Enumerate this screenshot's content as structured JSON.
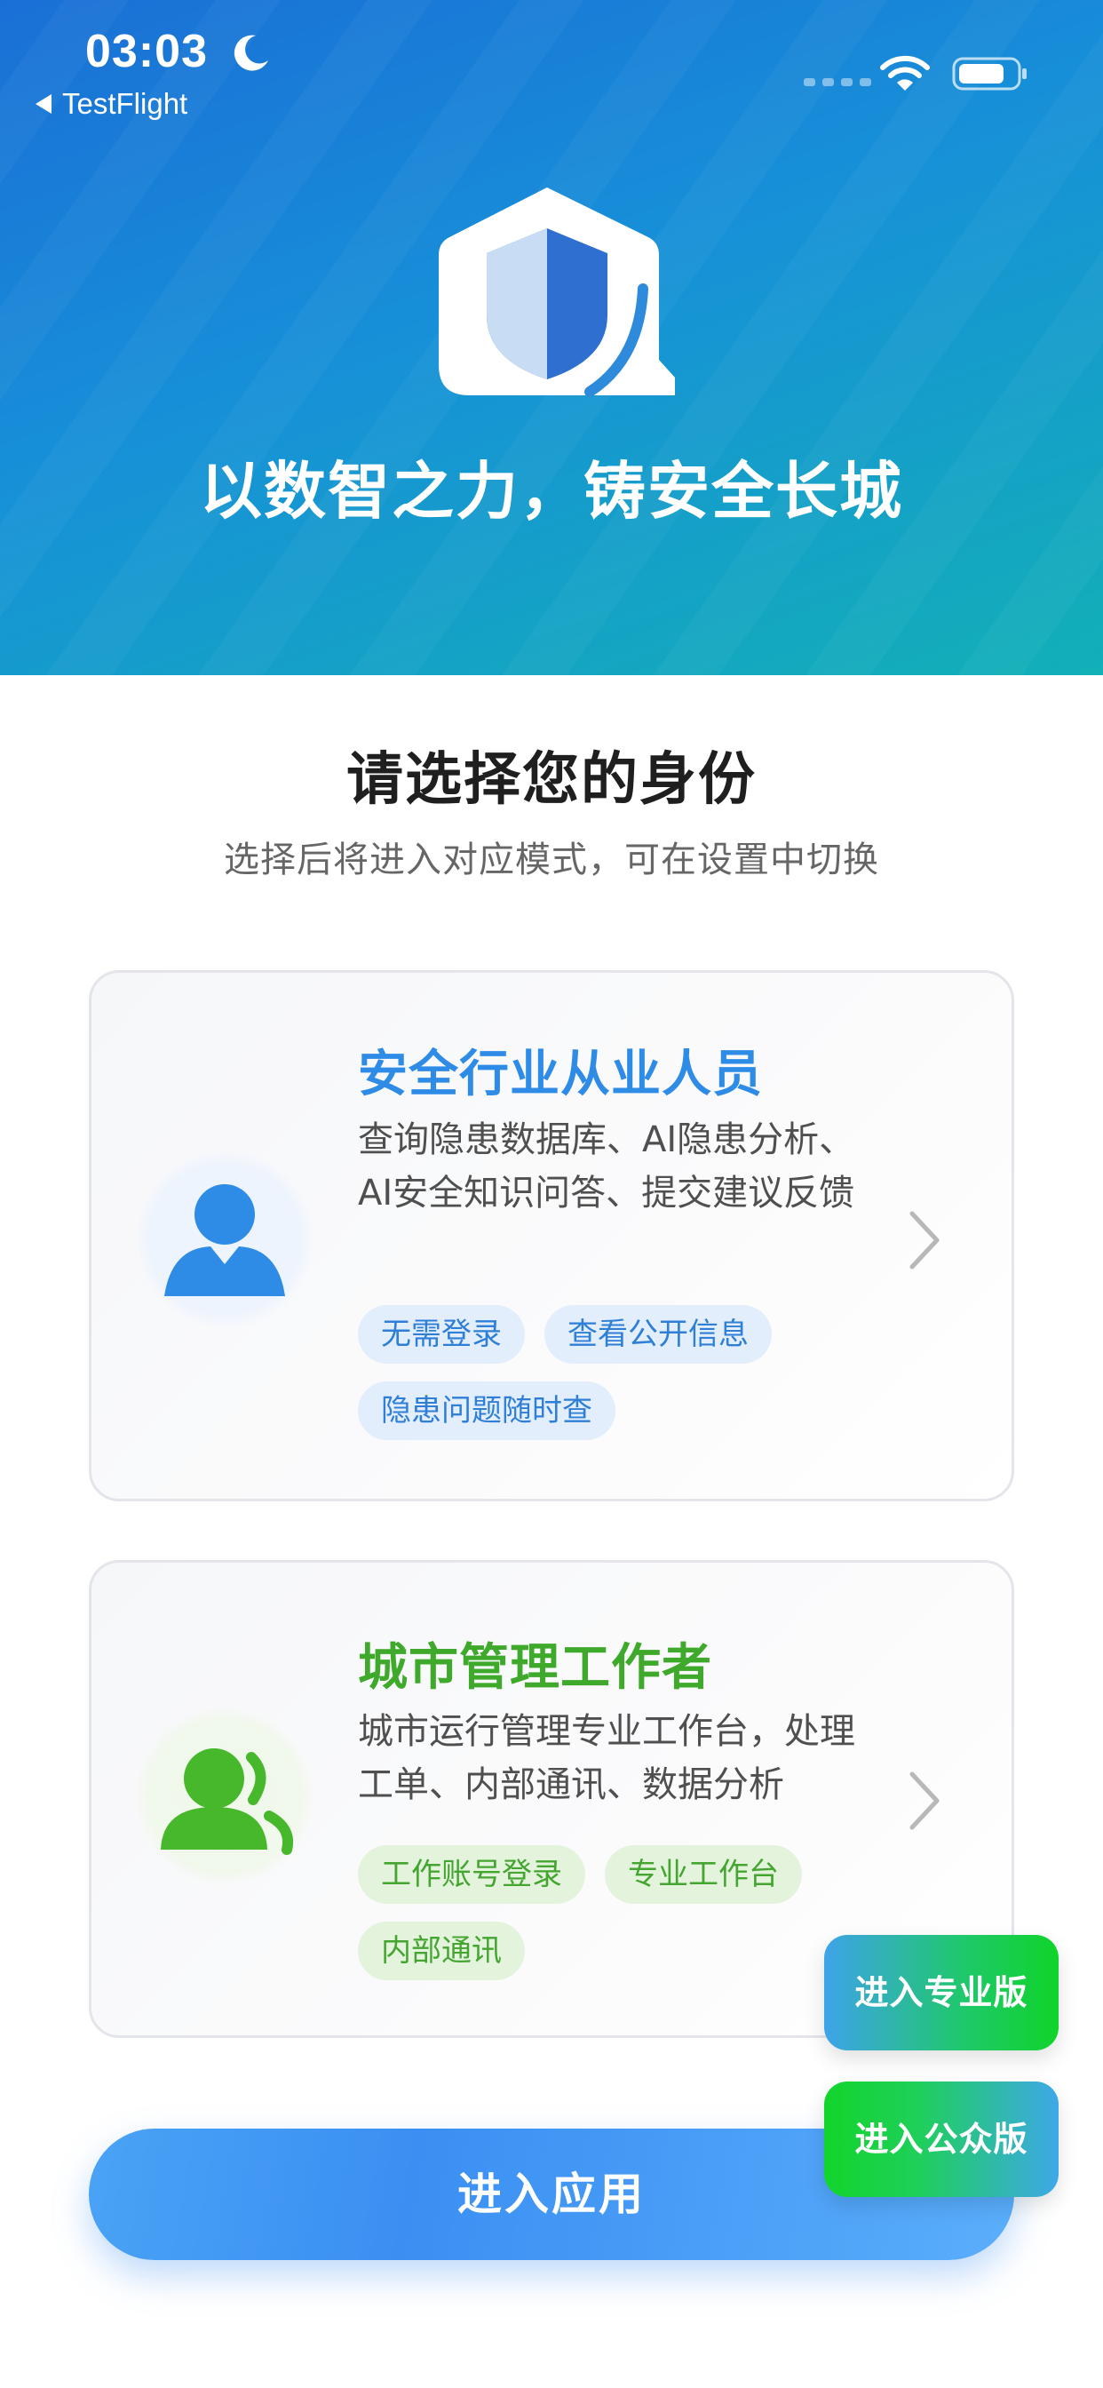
{
  "status_bar": {
    "time": "03:03",
    "back_app": "TestFlight"
  },
  "hero": {
    "slogan": "以数智之力，铸安全长城"
  },
  "header": {
    "title": "请选择您的身份",
    "subtitle": "选择后将进入对应模式，可在设置中切换"
  },
  "cards": [
    {
      "title": "安全行业从业人员",
      "description": "查询隐患数据库、AI隐患分析、AI安全知识问答、提交建议反馈",
      "tags": [
        "无需登录",
        "查看公开信息",
        "隐患问题随时查"
      ],
      "accent": "#2f8ce6",
      "icon": "person-icon"
    },
    {
      "title": "城市管理工作者",
      "description": "城市运行管理专业工作台，处理工单、内部通讯、数据分析",
      "tags": [
        "工作账号登录",
        "专业工作台",
        "内部通讯"
      ],
      "accent": "#3ea92a",
      "icon": "group-icon"
    }
  ],
  "buttons": {
    "enter_app": "进入应用",
    "enter_pro": "进入专业版",
    "enter_public": "进入公众版"
  }
}
